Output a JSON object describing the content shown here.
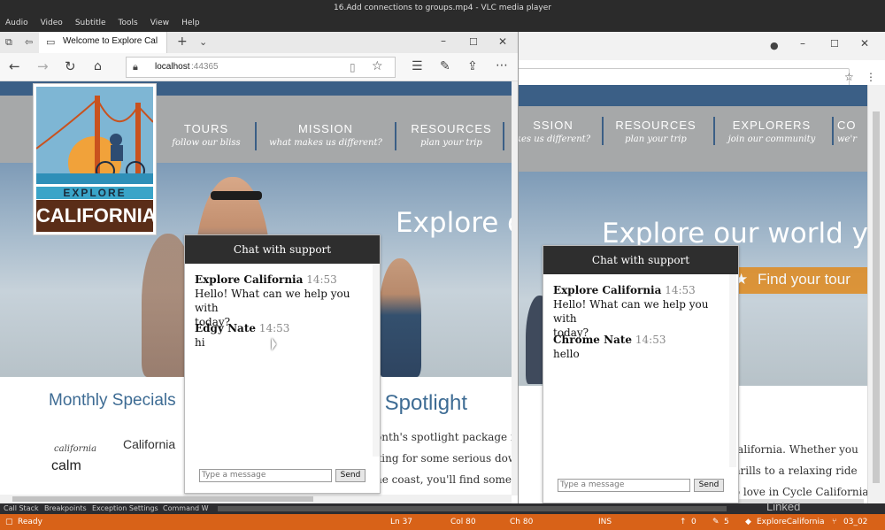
{
  "vlc": {
    "title": "16.Add connections to groups.mp4 - VLC media player",
    "menu": [
      "Audio",
      "Video",
      "Subtitle",
      "Tools",
      "View",
      "Help"
    ]
  },
  "edge": {
    "tab_title": "Welcome to Explore Cal",
    "address": "localhost",
    "port": ":44365"
  },
  "site": {
    "logo_line1": "EXPLORE",
    "logo_line2": "CALIFORNIA",
    "nav_left": [
      {
        "title": "TOURS",
        "sub": "follow our bliss"
      },
      {
        "title": "MISSION",
        "sub": "what makes us different?"
      },
      {
        "title": "RESOURCES",
        "sub": "plan your trip"
      }
    ],
    "nav_right": [
      {
        "title": "SSION",
        "sub": "kes us different?"
      },
      {
        "title": "RESOURCES",
        "sub": "plan your trip"
      },
      {
        "title": "EXPLORERS",
        "sub": "join our community"
      },
      {
        "title": "CO",
        "sub": "we'r"
      }
    ],
    "hero_left": "Explore o",
    "hero_right": "Explore our world y",
    "find_tour": "Find your tour",
    "monthly_specials": "Monthly Specials",
    "spotlight": "r Spotlight",
    "left_text": [
      "onth's spotlight package is",
      "king for some serious dow",
      "he coast, you'll find someth"
    ],
    "right_text": [
      "California. Whether you",
      "thrills to a relaxing ride",
      "to love in Cycle California."
    ],
    "specials_item": "California",
    "calm_small": "california",
    "calm_big": "calm"
  },
  "chat_left": {
    "header": "Chat with support",
    "messages": [
      {
        "author": "Explore California",
        "time": "14:53",
        "text1": "Hello! What can we help you with",
        "text2": "today?"
      },
      {
        "author": "Edgy Nate",
        "time": "14:53",
        "text1": "hi",
        "text2": ""
      }
    ],
    "placeholder": "Type a message",
    "send": "Send"
  },
  "chat_right": {
    "header": "Chat with support",
    "messages": [
      {
        "author": "Explore California",
        "time": "14:53",
        "text1": "Hello! What can we help you with",
        "text2": "today?"
      },
      {
        "author": "Chrome Nate",
        "time": "14:53",
        "text1": "hello",
        "text2": ""
      }
    ],
    "placeholder": "Type a message",
    "send": "Send"
  },
  "vs_tabs": [
    "Call Stack",
    "Breakpoints",
    "Exception Settings",
    "Command W"
  ],
  "status": {
    "ready": "Ready",
    "ln": "Ln 37",
    "col": "Col 80",
    "ch": "Ch 80",
    "ins": "INS",
    "up": "0",
    "edits": "5",
    "project": "ExploreCalifornia",
    "branch": "03_02",
    "watermark": "Linked"
  },
  "colors": {
    "site_blue": "#3b5f86",
    "nav_gray": "#a6a8a9",
    "status_orange": "#d86218",
    "chat_header": "#2e2e2e",
    "tour_orange": "#e08a1e"
  }
}
